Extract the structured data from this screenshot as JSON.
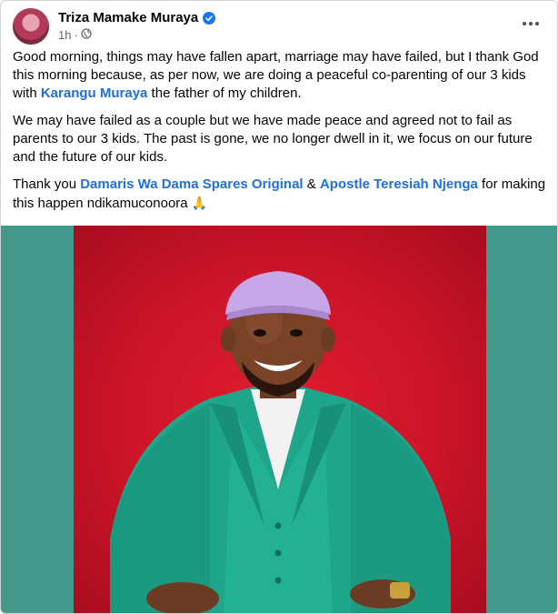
{
  "post": {
    "author_name": "Triza Mamake Muraya",
    "timestamp": "1h",
    "visibility_icon": "globe-icon",
    "more_icon": "more-options-icon",
    "paragraph1": {
      "before": "Good morning, things may have fallen apart, marriage may have failed, but I thank God this morning because, as per now, we are doing a peaceful co-parenting of our 3 kids with ",
      "mention": "Karangu Muraya",
      "after": " the father of  my children."
    },
    "paragraph2": "We may have failed as a couple but we have made peace and agreed not to fail as parents to our 3 kids. The past is gone, we no longer dwell in it, we focus on our future and the future of our kids.",
    "paragraph3": {
      "before": "Thank you ",
      "mention1": "Damaris Wa Dama Spares Original",
      "middle": " & ",
      "mention2": "Apostle Teresiah Njenga",
      "after": " for making this happen ndikamuconoora ",
      "emoji": "🙏"
    }
  },
  "colors": {
    "mention": "#216fdb",
    "photo_side_bg": "#43998b",
    "photo_backdrop": "#cc1428",
    "suit": "#1fa58a",
    "hat": "#c7a7e8",
    "verified_badge": "#1877f2"
  }
}
